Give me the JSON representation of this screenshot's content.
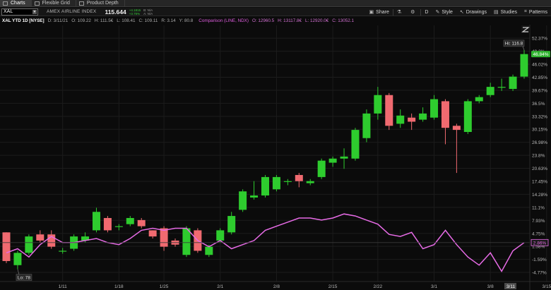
{
  "top_tabs": [
    {
      "label": "Charts",
      "active": true
    },
    {
      "label": "Flexible Grid",
      "active": false
    },
    {
      "label": "Product Depth",
      "active": false
    }
  ],
  "toolbar": {
    "symbol": "XAL",
    "instrument_name": "AMEX AIRLINE INDEX",
    "last_price": "115.644",
    "change_line1": "+4.1815",
    "change_line2": "+3.75%",
    "bid_line": "B: N/A",
    "ask_line": "A: N/A",
    "buttons": {
      "share": "Share",
      "flask": "",
      "settings": "",
      "period": "D",
      "style": "Style",
      "drawings": "Drawings",
      "studies": "Studies",
      "patterns": "Patterns"
    }
  },
  "info_bar": {
    "title": "XAL YTD 1D [NYSE]",
    "date": "D: 3/11/21",
    "open": "O: 109.22",
    "high": "H: 111.5€",
    "low": "L: 108.41",
    "close": "C: 109.11",
    "range": "R: 3.14",
    "extra": "Y: 80.8",
    "comparison_label": "Comparison (LINE, NDX)",
    "comp_open": "O: 12960.5",
    "comp_high": "H: 13117.8€",
    "comp_low": "L: 12920.0€",
    "comp_close": "C: 13052.1"
  },
  "colors": {
    "up": "#2ecc2e",
    "down": "#f06a70",
    "comparison": "#e76be6",
    "background": "#0b0b0b",
    "grid": "#1c1c1c",
    "axis_text": "#b8b8b8"
  },
  "chart_data": {
    "type": "candlestick",
    "symbol": "XAL",
    "comparison_symbol": "NDX",
    "y_axis_labels": [
      "52.37%",
      "49.2%",
      "46.02%",
      "42.85%",
      "39.67%",
      "36.5%",
      "33.32%",
      "30.15%",
      "26.98%",
      "23.8%",
      "20.63%",
      "17.45%",
      "14.28%",
      "11.1%",
      "7.93%",
      "4.75%",
      "1.58%",
      "-1.59%",
      "-4.77%"
    ],
    "y_tick_values": [
      52.37,
      49.2,
      46.02,
      42.85,
      39.67,
      36.5,
      33.32,
      30.15,
      26.98,
      23.8,
      20.63,
      17.45,
      14.28,
      11.1,
      7.93,
      4.75,
      1.58,
      -1.59,
      -4.77
    ],
    "y_range_percent": [
      -7.0,
      55.5
    ],
    "x_axis_labels": [
      "1/11",
      "1/18",
      "1/25",
      "2/1",
      "2/8",
      "2/15",
      "2/22",
      "3/1",
      "3/8",
      "3/15"
    ],
    "x_label_dates": [
      "2021-01-11",
      "2021-01-18",
      "2021-01-25",
      "2021-02-01",
      "2021-02-08",
      "2021-02-15",
      "2021-02-22",
      "2021-03-01",
      "2021-03-08",
      "2021-03-15"
    ],
    "current_date_marker": "3/11",
    "hi_marker": "Hi: 116.8",
    "lo_marker": "Lo: 78",
    "last_change_badge": "46.84%",
    "comparison_badge": "2.86%",
    "candles": [
      {
        "date": "2021-01-04",
        "o": 5.0,
        "h": 5.0,
        "l": -2.5,
        "c": -2.0
      },
      {
        "date": "2021-01-05",
        "o": -3.0,
        "h": 0.5,
        "l": -4.0,
        "c": 0.0
      },
      {
        "date": "2021-01-06",
        "o": 0.0,
        "h": 4.5,
        "l": -0.5,
        "c": 4.0
      },
      {
        "date": "2021-01-07",
        "o": 4.5,
        "h": 5.5,
        "l": 2.5,
        "c": 3.0
      },
      {
        "date": "2021-01-08",
        "o": 4.5,
        "h": 5.5,
        "l": 1.0,
        "c": 1.5
      },
      {
        "date": "2021-01-11",
        "o": 0.5,
        "h": 1.2,
        "l": -0.2,
        "c": 0.5
      },
      {
        "date": "2021-01-12",
        "o": 1.0,
        "h": 4.5,
        "l": 0.5,
        "c": 4.0
      },
      {
        "date": "2021-01-13",
        "o": 3.0,
        "h": 5.0,
        "l": 2.5,
        "c": 4.0
      },
      {
        "date": "2021-01-14",
        "o": 5.5,
        "h": 11.0,
        "l": 5.0,
        "c": 10.0
      },
      {
        "date": "2021-01-15",
        "o": 8.5,
        "h": 9.0,
        "l": 5.0,
        "c": 5.5
      },
      {
        "date": "2021-01-19",
        "o": 6.5,
        "h": 7.0,
        "l": 5.5,
        "c": 6.5
      },
      {
        "date": "2021-01-20",
        "o": 7.0,
        "h": 9.0,
        "l": 6.5,
        "c": 8.5
      },
      {
        "date": "2021-01-21",
        "o": 8.0,
        "h": 8.5,
        "l": 6.0,
        "c": 6.5
      },
      {
        "date": "2021-01-22",
        "o": 5.5,
        "h": 5.5,
        "l": 3.5,
        "c": 4.0
      },
      {
        "date": "2021-01-25",
        "o": 6.0,
        "h": 6.5,
        "l": 0.5,
        "c": 1.5
      },
      {
        "date": "2021-01-26",
        "o": 3.0,
        "h": 3.5,
        "l": 1.5,
        "c": 2.0
      },
      {
        "date": "2021-01-27",
        "o": -0.5,
        "h": 6.5,
        "l": -1.0,
        "c": 6.0
      },
      {
        "date": "2021-01-28",
        "o": 5.5,
        "h": 6.0,
        "l": 0.0,
        "c": 0.5
      },
      {
        "date": "2021-01-29",
        "o": -0.5,
        "h": 2.0,
        "l": -1.0,
        "c": 1.5
      },
      {
        "date": "2021-02-01",
        "o": 3.0,
        "h": 6.0,
        "l": 2.5,
        "c": 5.5
      },
      {
        "date": "2021-02-02",
        "o": 5.0,
        "h": 10.0,
        "l": 4.5,
        "c": 9.0
      },
      {
        "date": "2021-02-03",
        "o": 10.5,
        "h": 15.5,
        "l": 10.0,
        "c": 15.0
      },
      {
        "date": "2021-02-04",
        "o": 13.5,
        "h": 17.5,
        "l": 13.0,
        "c": 14.0
      },
      {
        "date": "2021-02-05",
        "o": 14.0,
        "h": 19.0,
        "l": 13.5,
        "c": 18.5
      },
      {
        "date": "2021-02-08",
        "o": 15.5,
        "h": 19.0,
        "l": 15.0,
        "c": 18.5
      },
      {
        "date": "2021-02-09",
        "o": 17.5,
        "h": 18.0,
        "l": 16.5,
        "c": 17.5
      },
      {
        "date": "2021-02-10",
        "o": 19.0,
        "h": 19.5,
        "l": 16.0,
        "c": 17.5
      },
      {
        "date": "2021-02-11",
        "o": 17.0,
        "h": 18.0,
        "l": 16.5,
        "c": 17.5
      },
      {
        "date": "2021-02-12",
        "o": 18.5,
        "h": 23.0,
        "l": 18.0,
        "c": 22.5
      },
      {
        "date": "2021-02-16",
        "o": 22.0,
        "h": 23.5,
        "l": 21.0,
        "c": 23.0
      },
      {
        "date": "2021-02-17",
        "o": 23.0,
        "h": 25.5,
        "l": 20.5,
        "c": 23.5
      },
      {
        "date": "2021-02-18",
        "o": 23.0,
        "h": 30.5,
        "l": 22.5,
        "c": 30.0
      },
      {
        "date": "2021-02-19",
        "o": 28.0,
        "h": 35.0,
        "l": 27.0,
        "c": 34.0
      },
      {
        "date": "2021-02-22",
        "o": 34.0,
        "h": 40.5,
        "l": 32.5,
        "c": 38.5
      },
      {
        "date": "2021-02-23",
        "o": 38.5,
        "h": 39.0,
        "l": 30.0,
        "c": 31.0
      },
      {
        "date": "2021-02-24",
        "o": 31.5,
        "h": 35.0,
        "l": 30.5,
        "c": 33.5
      },
      {
        "date": "2021-02-25",
        "o": 33.0,
        "h": 34.0,
        "l": 30.0,
        "c": 32.0
      },
      {
        "date": "2021-02-26",
        "o": 32.5,
        "h": 35.5,
        "l": 32.0,
        "c": 34.0
      },
      {
        "date": "2021-03-01",
        "o": 33.0,
        "h": 38.5,
        "l": 32.5,
        "c": 37.5
      },
      {
        "date": "2021-03-02",
        "o": 37.0,
        "h": 37.5,
        "l": 26.5,
        "c": 30.5
      },
      {
        "date": "2021-03-03",
        "o": 31.0,
        "h": 31.5,
        "l": 19.5,
        "c": 30.0
      },
      {
        "date": "2021-03-04",
        "o": 29.5,
        "h": 37.5,
        "l": 29.0,
        "c": 37.0
      },
      {
        "date": "2021-03-05",
        "o": 37.0,
        "h": 38.5,
        "l": 36.5,
        "c": 38.0
      },
      {
        "date": "2021-03-08",
        "o": 38.5,
        "h": 41.5,
        "l": 38.0,
        "c": 40.5
      },
      {
        "date": "2021-03-09",
        "o": 40.5,
        "h": 42.5,
        "l": 39.5,
        "c": 40.5
      },
      {
        "date": "2021-03-10",
        "o": 40.0,
        "h": 43.5,
        "l": 39.5,
        "c": 43.0
      },
      {
        "date": "2021-03-11",
        "o": 43.0,
        "h": 49.5,
        "l": 42.5,
        "c": 48.5
      }
    ],
    "comparison_line": {
      "name": "NDX",
      "values": [
        0.0,
        1.0,
        -1.0,
        2.0,
        4.0,
        2.5,
        2.5,
        3.0,
        3.5,
        2.5,
        2.0,
        3.5,
        5.5,
        6.0,
        5.5,
        6.0,
        6.0,
        3.0,
        1.5,
        3.0,
        1.0,
        2.0,
        3.0,
        5.5,
        6.5,
        7.5,
        8.5,
        8.5,
        8.0,
        8.5,
        9.5,
        9.0,
        8.0,
        7.0,
        4.5,
        4.0,
        5.0,
        1.0,
        2.0,
        5.5,
        2.0,
        -1.0,
        -3.0,
        0.0,
        -4.5,
        0.5,
        2.5
      ]
    }
  }
}
